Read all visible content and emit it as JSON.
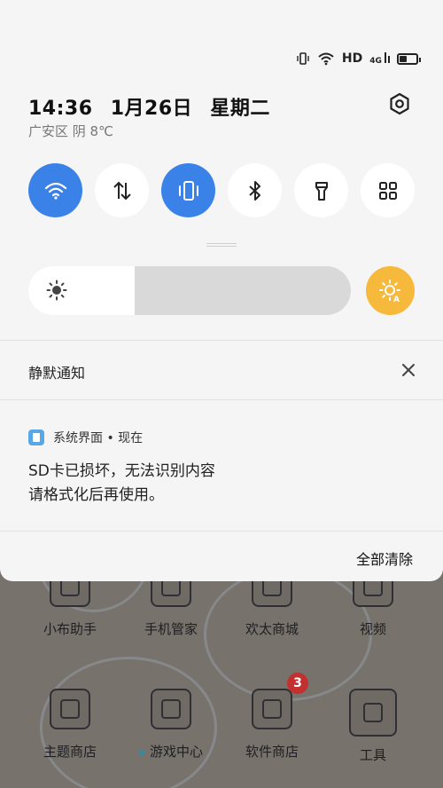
{
  "status_bar": {
    "network_label": "HD",
    "network_gen": "4G"
  },
  "header": {
    "time": "14:36",
    "date": "1月26日",
    "weekday": "星期二",
    "weather": "广安区 阴 8℃"
  },
  "toggles": [
    {
      "name": "wifi",
      "icon": "wifi-icon",
      "on": true
    },
    {
      "name": "mobile-data",
      "icon": "data-arrows-icon",
      "on": false
    },
    {
      "name": "vibrate",
      "icon": "vibrate-icon",
      "on": true
    },
    {
      "name": "bluetooth",
      "icon": "bluetooth-icon",
      "on": false
    },
    {
      "name": "flashlight",
      "icon": "flashlight-icon",
      "on": false
    },
    {
      "name": "more",
      "icon": "grid-icon",
      "on": false
    }
  ],
  "brightness": {
    "level": 0.33,
    "auto": true
  },
  "silent_section": {
    "title": "静默通知"
  },
  "notification": {
    "app_name": "系统界面 • 现在",
    "line1": "SD卡已损坏，无法识别内容",
    "line2": "请格式化后再使用。"
  },
  "clear_all_label": "全部清除",
  "home_apps": [
    {
      "label": "小布助手"
    },
    {
      "label": "手机管家"
    },
    {
      "label": "欢太商城"
    },
    {
      "label": "视频"
    },
    {
      "label": "主题商店"
    },
    {
      "label": "游戏中心"
    },
    {
      "label": "软件商店",
      "badge": "3"
    },
    {
      "label": "工具"
    }
  ],
  "colors": {
    "accent": "#3b82e8",
    "auto_brightness": "#f6b93b",
    "badge": "#c23030"
  }
}
